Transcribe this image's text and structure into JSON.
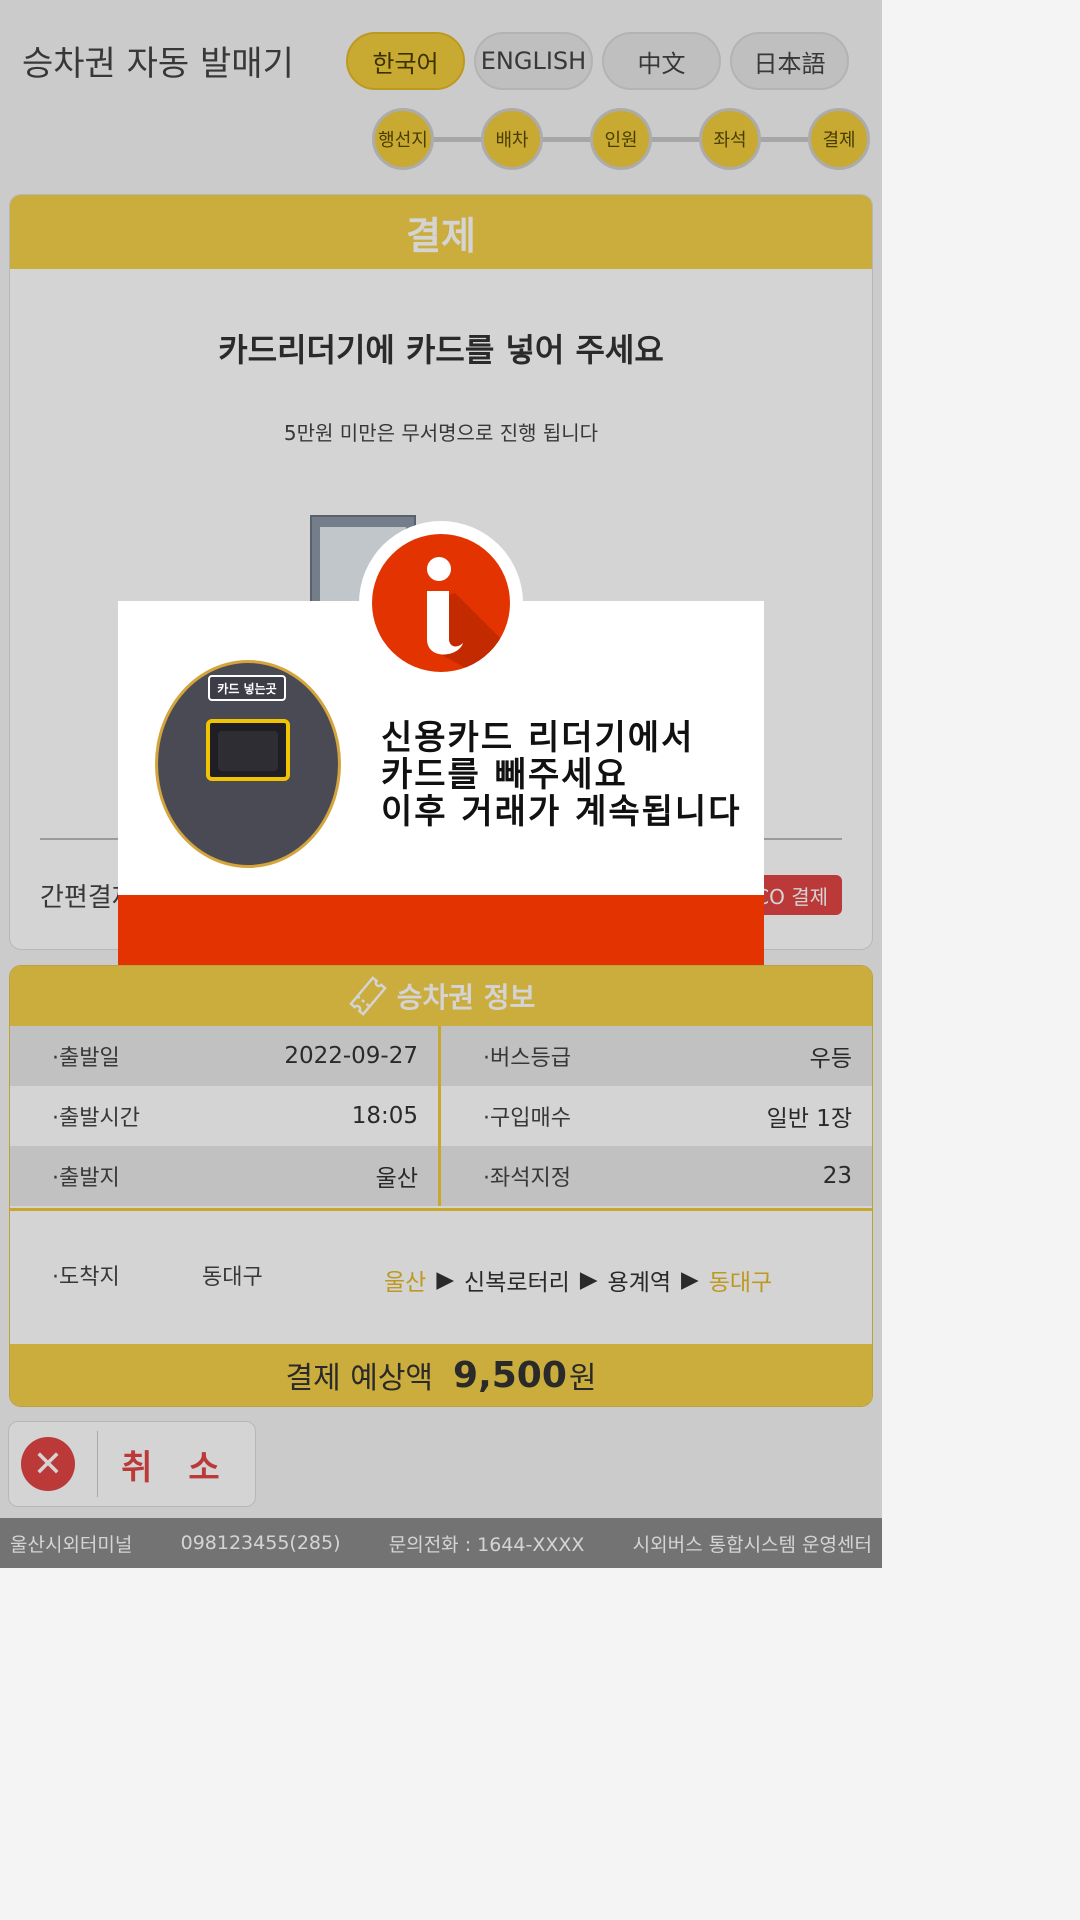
{
  "header": {
    "title": "승차권 자동 발매기",
    "languages": [
      "한국어",
      "ENGLISH",
      "中文",
      "日本語"
    ],
    "steps": [
      "행선지",
      "배차",
      "인원",
      "좌석",
      "결제"
    ]
  },
  "payment": {
    "heading": "결제",
    "instruction": "카드리더기에 카드를 넣어 주세요",
    "note": "5만원 미만은 무서명으로 진행 됩니다",
    "easy_pay_label": "간편결제",
    "eco_button": "CO 결제"
  },
  "ticket": {
    "heading": "승차권 정보",
    "rows": [
      {
        "l_label": "·출발일",
        "l_value": "2022-09-27",
        "r_label": "·버스등급",
        "r_value": "우등"
      },
      {
        "l_label": "·출발시간",
        "l_value": "18:05",
        "r_label": "·구입매수",
        "r_value": "일반 1장"
      },
      {
        "l_label": "·출발지",
        "l_value": "울산",
        "r_label": "·좌석지정",
        "r_value": "23"
      }
    ],
    "arrival_label": "·도착지",
    "arrival_value": "동대구",
    "route": [
      "울산",
      "신복로터리",
      "용계역",
      "동대구"
    ],
    "total_label": "결제 예상액",
    "total_amount": "9,500",
    "total_unit": "원"
  },
  "cancel_label": "취 소",
  "footer": {
    "terminal": "울산시외터미널",
    "code": "098123455(285)",
    "contact": "문의전화 : 1644-XXXX",
    "operator": "시외버스 통합시스템 운영센터"
  },
  "modal": {
    "slot_label": "카드 넣는곳",
    "line1": "신용카드 리더기에서",
    "line2": "카드를 빼주세요",
    "line3": "이후 거래가 계속됩니다"
  },
  "colors": {
    "accent": "#f3d04a",
    "alert": "#e33300",
    "cancel": "#e34545"
  }
}
